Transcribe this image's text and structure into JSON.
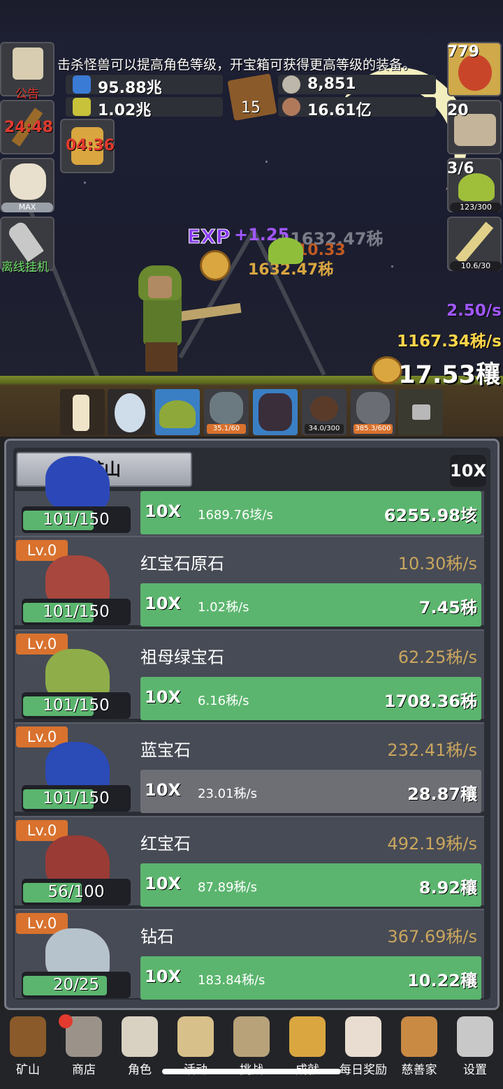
{
  "hud": {
    "tip": "击杀怪兽可以提高角色等级，开宝箱可获得更高等级的装备。",
    "res_blue_potion": "95.88兆",
    "res_yellow_potion": "1.02兆",
    "book_count": "15",
    "res_silver": "8,851",
    "res_meat": "16.61亿",
    "notice_label": "公告",
    "torch_timer": "24:48",
    "chest_timer": "04:36",
    "bonus_label": "MAX",
    "offline_label": "离线挂机"
  },
  "right_side": {
    "potion_count": "779",
    "chest_count": "20",
    "slime_count": "3/6",
    "slime_progress": "123/300",
    "sword_progress": "10.6/30"
  },
  "battle": {
    "exp_tag": "EXP",
    "exp_gain": "+1.25",
    "float_coin_1": "+1632.47秭",
    "float_coin_2": "1632.47秭",
    "float_num": "10.33",
    "rate_exp": "2.50/s",
    "rate_coin": "1167.34秭/s",
    "total_coin": "17.53穰"
  },
  "slots": [
    {
      "name": "candle",
      "bar": ""
    },
    {
      "name": "egg",
      "bar": ""
    },
    {
      "name": "slime",
      "bar": ""
    },
    {
      "name": "ghost",
      "bar": "35.1/60"
    },
    {
      "name": "bat",
      "bar": ""
    },
    {
      "name": "spider",
      "bar": "34.0/300"
    },
    {
      "name": "golem",
      "bar": "385.3/600"
    },
    {
      "name": "locked",
      "bar": ""
    }
  ],
  "panel": {
    "tab_label": "矿山",
    "mult_label": "10X"
  },
  "mines": [
    {
      "level": "",
      "name": "",
      "rate": "",
      "progress": "101/150",
      "progress_frac": 0.67,
      "mult": "10X",
      "per": "1689.76垓/s",
      "cost": "6255.98垓",
      "gem_color": "#2c48b8",
      "affordable": true
    },
    {
      "level": "Lv.0",
      "name": "红宝石原石",
      "rate": "10.30秭/s",
      "progress": "101/150",
      "progress_frac": 0.67,
      "mult": "10X",
      "per": "1.02秭/s",
      "cost": "7.45秭",
      "gem_color": "#a8473e",
      "affordable": true
    },
    {
      "level": "Lv.0",
      "name": "祖母绿宝石",
      "rate": "62.25秭/s",
      "progress": "101/150",
      "progress_frac": 0.67,
      "mult": "10X",
      "per": "6.16秭/s",
      "cost": "1708.36秭",
      "gem_color": "#8fae4a",
      "affordable": true
    },
    {
      "level": "Lv.0",
      "name": "蓝宝石",
      "rate": "232.41秭/s",
      "progress": "101/150",
      "progress_frac": 0.67,
      "mult": "10X",
      "per": "23.01秭/s",
      "cost": "28.87穰",
      "gem_color": "#2b4bb7",
      "affordable": false
    },
    {
      "level": "Lv.0",
      "name": "红宝石",
      "rate": "492.19秭/s",
      "progress": "56/100",
      "progress_frac": 0.56,
      "mult": "10X",
      "per": "87.89秭/s",
      "cost": "8.92穰",
      "gem_color": "#9a3b36",
      "affordable": true
    },
    {
      "level": "Lv.0",
      "name": "钻石",
      "rate": "367.69秭/s",
      "progress": "20/25",
      "progress_frac": 0.8,
      "mult": "10X",
      "per": "183.84秭/s",
      "cost": "10.22穰",
      "gem_color": "#b7c3cc",
      "affordable": true
    }
  ],
  "nav": [
    {
      "label": "矿山",
      "icon": "lantern-icon",
      "color": "#8a5a2a"
    },
    {
      "label": "商店",
      "icon": "stone-icon",
      "color": "#9b938a"
    },
    {
      "label": "角色",
      "icon": "skull-icon",
      "color": "#d9d2c3"
    },
    {
      "label": "活动",
      "icon": "scroll-icon",
      "color": "#d8c08a"
    },
    {
      "label": "挑战",
      "icon": "map-icon",
      "color": "#b8a27a"
    },
    {
      "label": "成就",
      "icon": "key-icon",
      "color": "#d9a640"
    },
    {
      "label": "每日奖励",
      "icon": "letter-icon",
      "color": "#e8ddd0"
    },
    {
      "label": "慈善家",
      "icon": "bread-icon",
      "color": "#c98a44"
    },
    {
      "label": "设置",
      "icon": "gear-icon",
      "color": "#c8c8c8"
    }
  ]
}
